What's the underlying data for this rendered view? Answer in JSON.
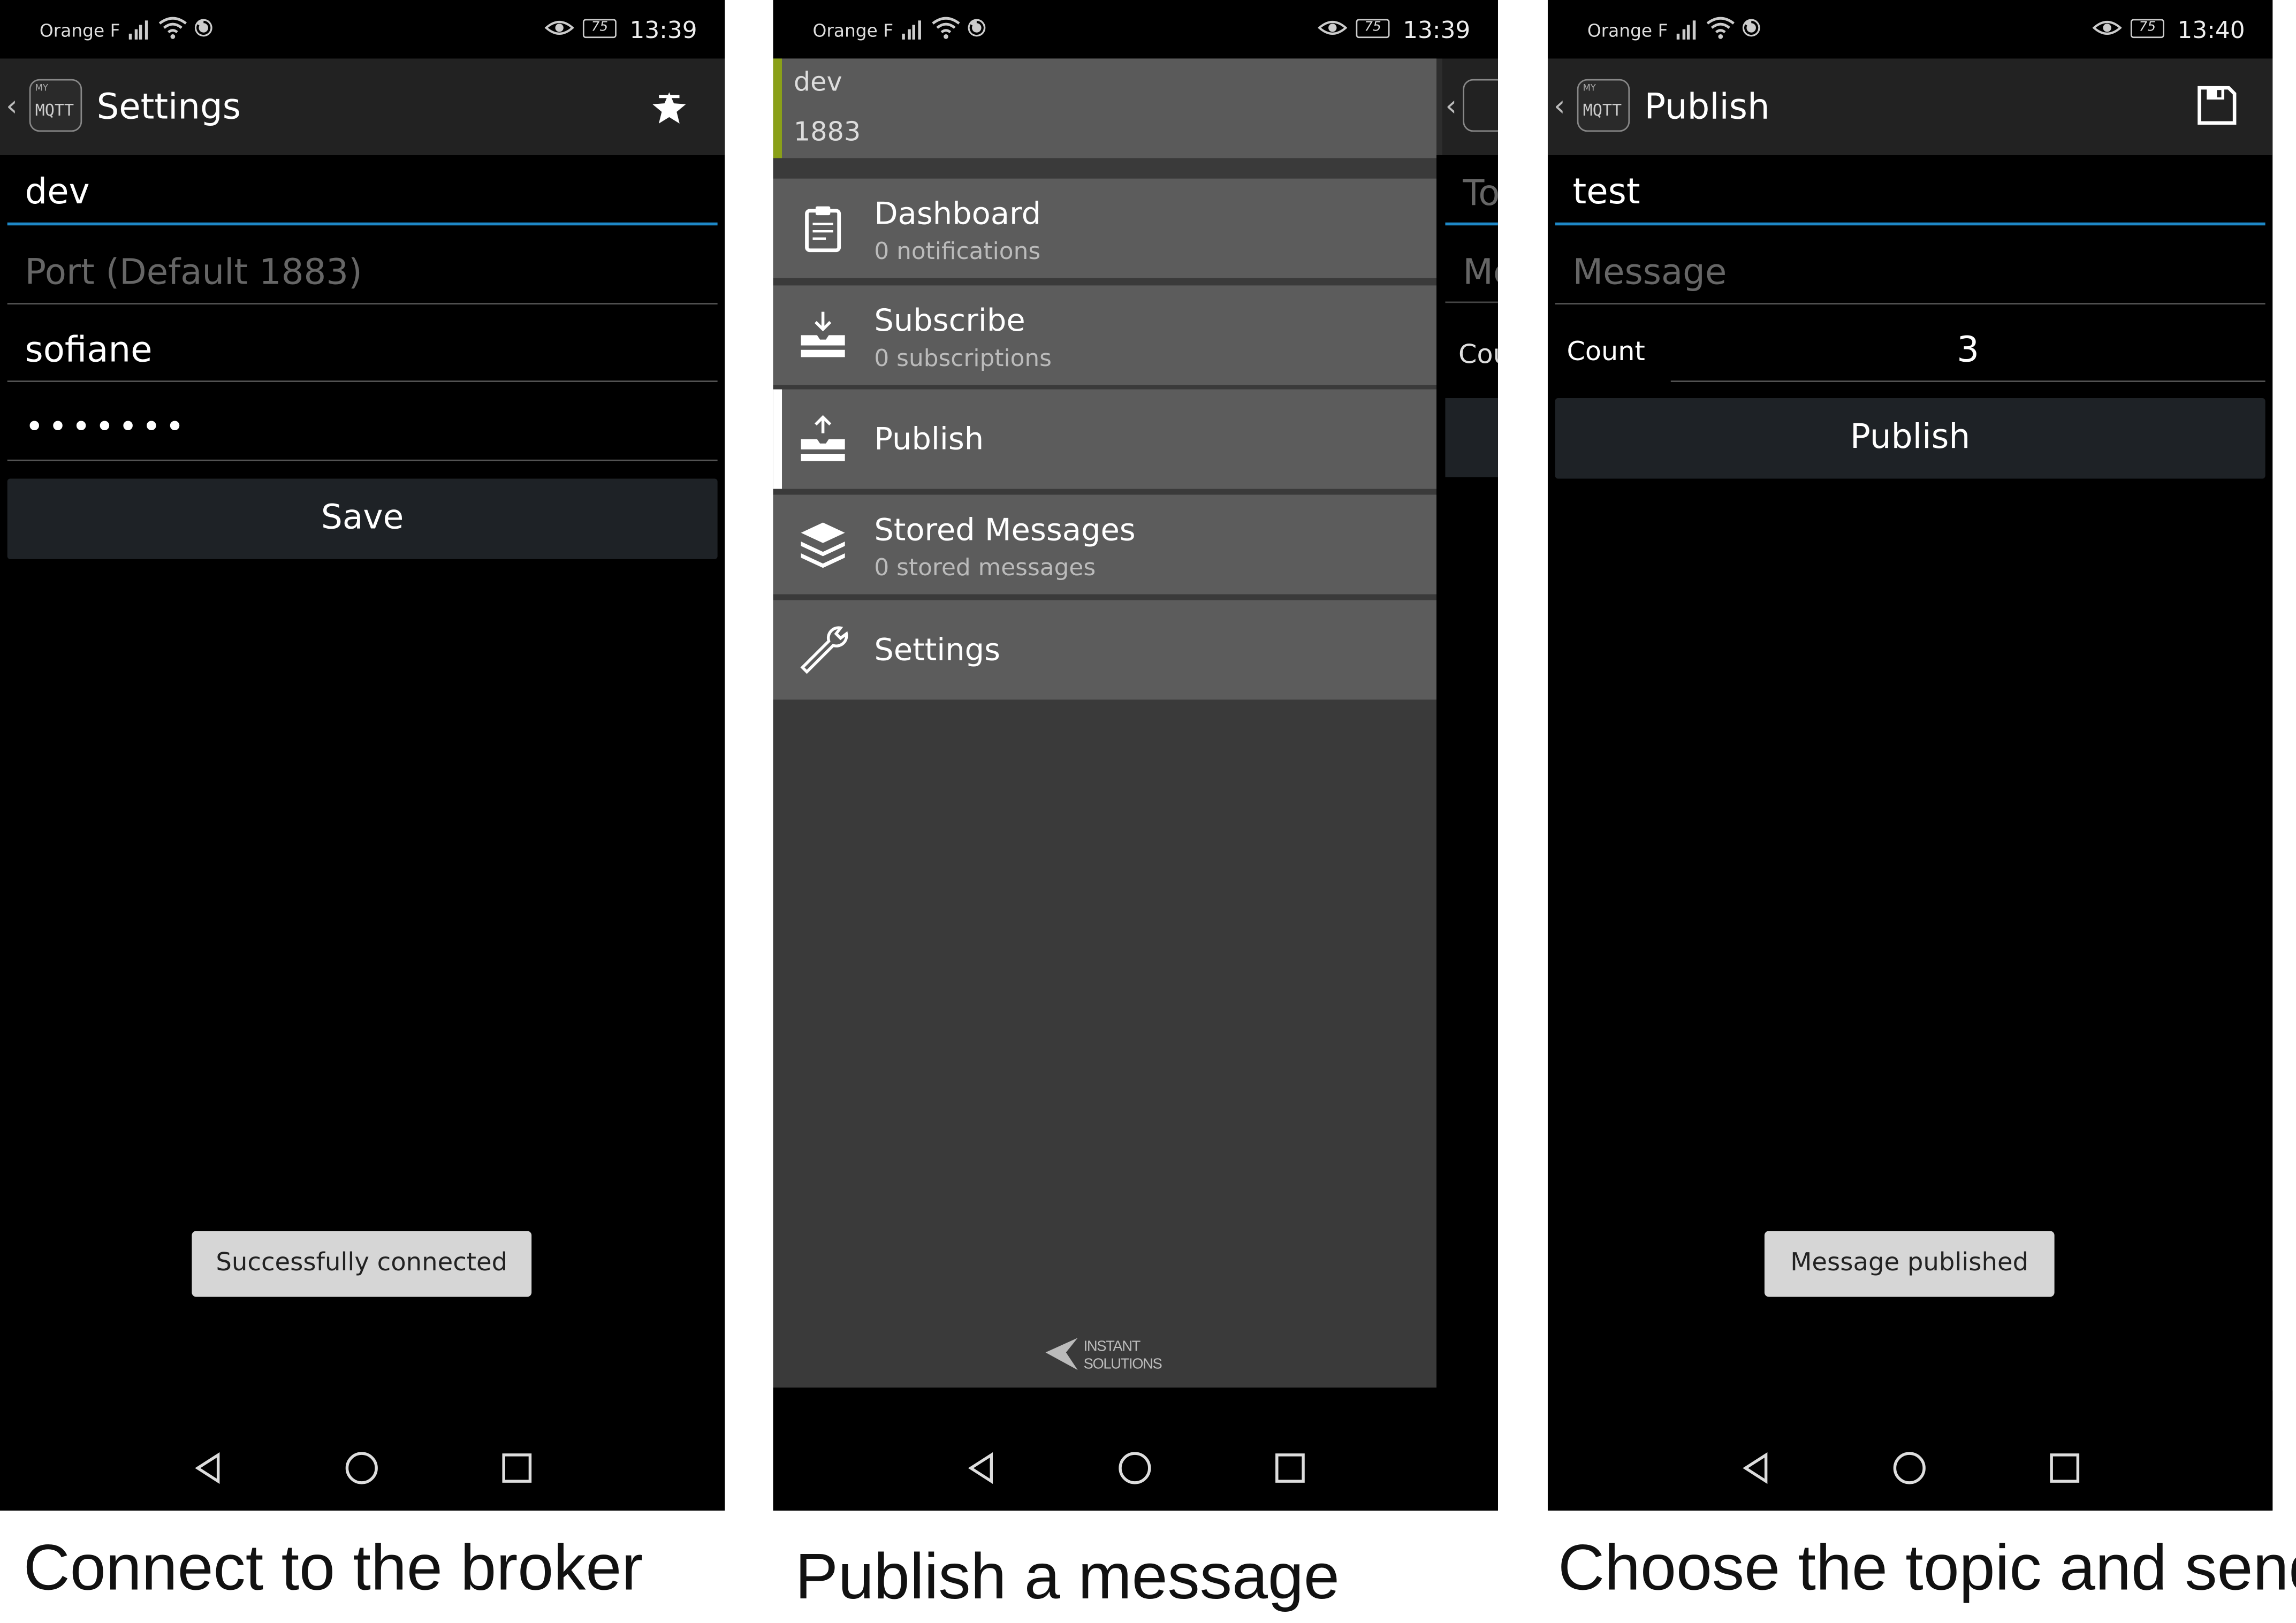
{
  "panels": [
    {
      "status": {
        "carrier": "Orange F",
        "battery": "75",
        "time": "13:39"
      },
      "appbar": {
        "title": "Settings",
        "logo_small": "MY",
        "logo_large": "MQTT",
        "action_icon": "star-icon"
      },
      "fields": {
        "host_value": "dev",
        "port_placeholder": "Port (Default 1883)",
        "username_value": "sofiane",
        "password_value": "•••••••"
      },
      "save_label": "Save",
      "toast": "Successfully connected",
      "caption": "Connect to the broker"
    },
    {
      "status": {
        "carrier": "Orange F",
        "battery": "75",
        "time": "13:39"
      },
      "drawer": {
        "host": "dev",
        "port": "1883",
        "items": [
          {
            "label": "Dashboard",
            "sub": "0 notifications",
            "icon": "clipboard-icon"
          },
          {
            "label": "Subscribe",
            "sub": "0 subscriptions",
            "icon": "subscribe-tray-icon"
          },
          {
            "label": "Publish",
            "sub": "",
            "icon": "publish-tray-icon"
          },
          {
            "label": "Stored Messages",
            "sub": "0 stored messages",
            "icon": "layers-icon"
          },
          {
            "label": "Settings",
            "sub": "",
            "icon": "wrench-icon"
          }
        ],
        "brand_line1": "INSTANT",
        "brand_line2": "SOLUTIONS"
      },
      "peek": {
        "topic": "To",
        "message": "Me",
        "count": "Cou"
      },
      "caption": "Publish a message"
    },
    {
      "status": {
        "carrier": "Orange F",
        "battery": "75",
        "time": "13:40"
      },
      "appbar": {
        "title": "Publish",
        "logo_small": "MY",
        "logo_large": "MQTT",
        "action_icon": "save-icon"
      },
      "fields": {
        "topic_value": "test",
        "message_placeholder": "Message",
        "count_label": "Count",
        "count_value": "3"
      },
      "publish_label": "Publish",
      "toast": "Message published",
      "caption": "Choose the topic and send"
    }
  ],
  "colors": {
    "accent_blue": "#1e88c7",
    "drawer_accent_green": "#8aa018",
    "button_bg": "#1e2226"
  }
}
